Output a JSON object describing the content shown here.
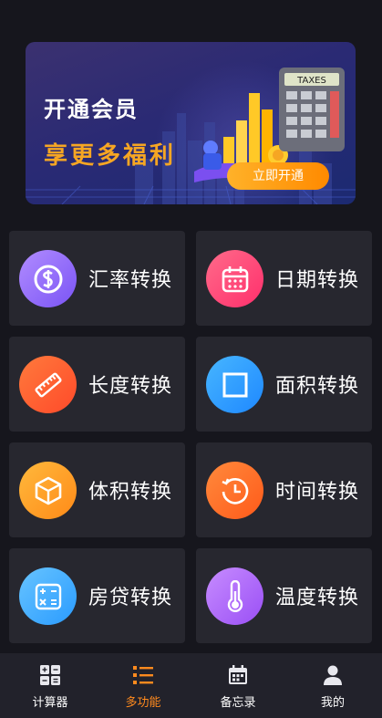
{
  "banner": {
    "title": "开通会员",
    "subtitle": "享更多福利",
    "cta_label": "立即开通",
    "calculator_label": "TAXES"
  },
  "features": [
    {
      "label": "汇率转换",
      "icon": "dollar-icon",
      "color_from": "#b18cff",
      "color_to": "#7a54f5"
    },
    {
      "label": "日期转换",
      "icon": "calendar-icon",
      "color_from": "#ff6b8a",
      "color_to": "#ff2f6c"
    },
    {
      "label": "长度转换",
      "icon": "ruler-icon",
      "color_from": "#ff7a3c",
      "color_to": "#ff4a2a"
    },
    {
      "label": "面积转换",
      "icon": "square-icon",
      "color_from": "#47b6ff",
      "color_to": "#1e88ff"
    },
    {
      "label": "体积转换",
      "icon": "cube-icon",
      "color_from": "#ffb93c",
      "color_to": "#ff8a18"
    },
    {
      "label": "时间转换",
      "icon": "clock-icon",
      "color_from": "#ff8a3c",
      "color_to": "#ff5a1a"
    },
    {
      "label": "房贷转换",
      "icon": "calculator-icon",
      "color_from": "#67c4ff",
      "color_to": "#2a9bff"
    },
    {
      "label": "温度转换",
      "icon": "thermometer-icon",
      "color_from": "#c78cff",
      "color_to": "#9a4ff5"
    }
  ],
  "tabbar": {
    "items": [
      {
        "label": "计算器",
        "icon": "calculator-icon",
        "active": false
      },
      {
        "label": "多功能",
        "icon": "list-icon",
        "active": true
      },
      {
        "label": "备忘录",
        "icon": "calendar-icon",
        "active": false
      },
      {
        "label": "我的",
        "icon": "person-icon",
        "active": false
      }
    ],
    "active_color": "#ff8a1e"
  }
}
